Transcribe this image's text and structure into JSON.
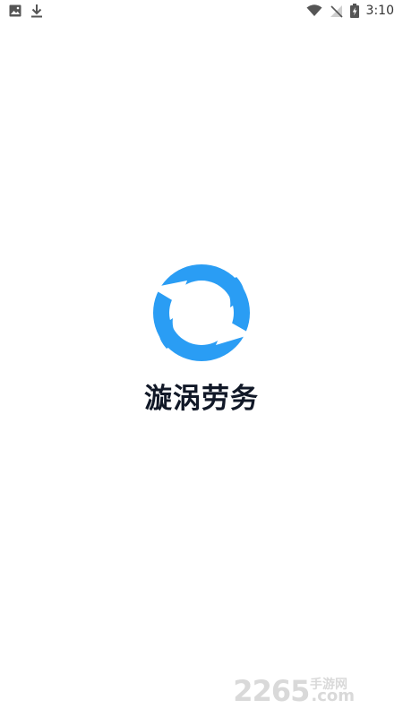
{
  "status_bar": {
    "time": "3:10",
    "left_icons": [
      "image-icon",
      "download-icon"
    ],
    "right_icons": [
      "wifi-icon",
      "no-signal-icon",
      "battery-charging-icon"
    ]
  },
  "splash": {
    "app_name": "漩涡劳务",
    "logo_icon": "swirl-logo-icon",
    "logo_color": "#2a9df4"
  },
  "watermark": {
    "number": "2265",
    "domain": ".com",
    "site_name": "手游网"
  }
}
